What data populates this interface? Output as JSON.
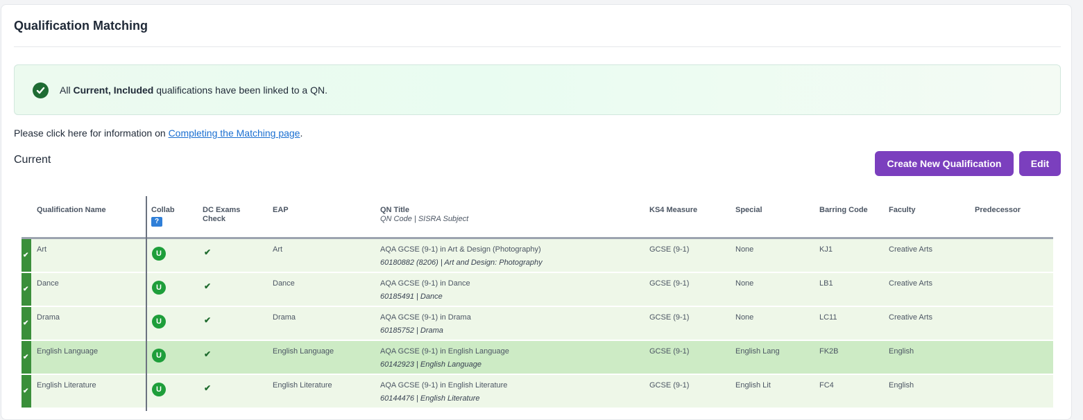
{
  "page": {
    "title": "Qualification Matching"
  },
  "alert": {
    "prefix": "All",
    "bold": "Current, Included",
    "suffix": "qualifications have been linked to a QN.",
    "icon": "check-circle-icon",
    "color": "#1e6b33"
  },
  "info": {
    "text": "Please click here for information on",
    "link": "Completing the Matching page",
    "end": "."
  },
  "section": {
    "title": "Current"
  },
  "buttons": {
    "create": "Create New Qualification",
    "edit": "Edit",
    "color": "#7b3fbe"
  },
  "table": {
    "headers": {
      "qualification_name": "Qualification Name",
      "collab": "Collab",
      "collab_help": "?",
      "dc_exams_line1": "DC Exams",
      "dc_exams_line2": "Check",
      "eap": "EAP",
      "qn_title": "QN Title",
      "qn_title_sub": "QN Code | SISRA Subject",
      "ks4": "KS4 Measure",
      "special": "Special",
      "barring": "Barring Code",
      "faculty": "Faculty",
      "predecessor": "Predecessor"
    },
    "rows": [
      {
        "name": "Art",
        "collab": "U",
        "eap": "Art",
        "qn_title": "AQA GCSE (9-1) in Art & Design (Photography)",
        "qn_code": "60180882 (8206) | Art and Design: Photography",
        "ks4": "GCSE (9-1)",
        "special": "None",
        "barring": "KJ1",
        "faculty": "Creative Arts"
      },
      {
        "name": "Dance",
        "collab": "U",
        "eap": "Dance",
        "qn_title": "AQA GCSE (9-1) in Dance",
        "qn_code": "60185491 | Dance",
        "ks4": "GCSE (9-1)",
        "special": "None",
        "barring": "LB1",
        "faculty": "Creative Arts"
      },
      {
        "name": "Drama",
        "collab": "U",
        "eap": "Drama",
        "qn_title": "AQA GCSE (9-1) in Drama",
        "qn_code": "60185752 | Drama",
        "ks4": "GCSE (9-1)",
        "special": "None",
        "barring": "LC11",
        "faculty": "Creative Arts"
      },
      {
        "name": "English Language",
        "collab": "U",
        "eap": "English Language",
        "qn_title": "AQA GCSE (9-1) in English Language",
        "qn_code": "60142923 | English Language",
        "ks4": "GCSE (9-1)",
        "special": "English Lang",
        "barring": "FK2B",
        "faculty": "English"
      },
      {
        "name": "English Literature",
        "collab": "U",
        "eap": "English Literature",
        "qn_title": "AQA GCSE (9-1) in English Literature",
        "qn_code": "60144476 | English Literature",
        "ks4": "GCSE (9-1)",
        "special": "English Lit",
        "barring": "FC4",
        "faculty": "English"
      }
    ]
  }
}
